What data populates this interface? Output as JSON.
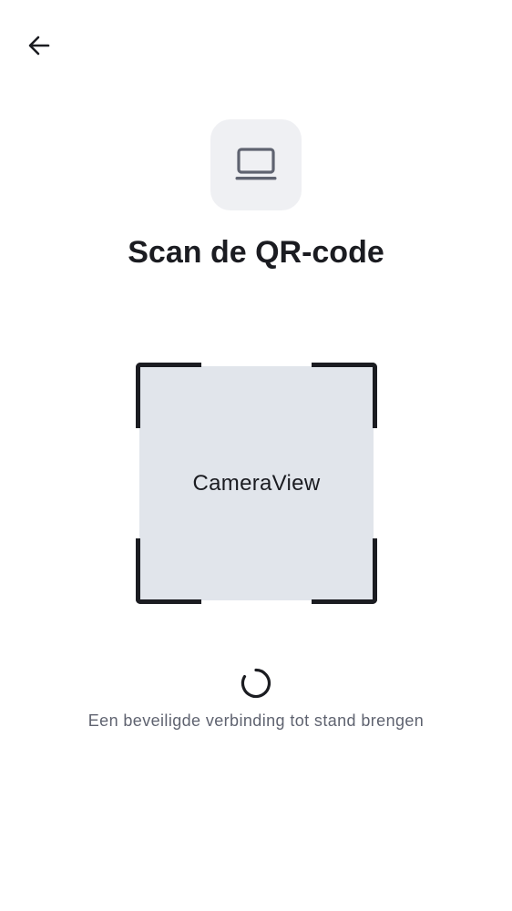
{
  "header": {
    "back_icon": "arrow-left-icon"
  },
  "device": {
    "icon": "laptop-icon"
  },
  "title": "Scan de QR-code",
  "scanner": {
    "camera_label": "CameraView"
  },
  "status": {
    "text": "Een beveiligde verbinding tot stand brengen",
    "spinner_icon": "loading-spinner-icon"
  },
  "colors": {
    "text_primary": "#1b1c21",
    "text_secondary": "#5f6370",
    "tile_background": "#eff0f3",
    "camera_background": "#e1e5eb",
    "icon_gray": "#5f6370"
  }
}
